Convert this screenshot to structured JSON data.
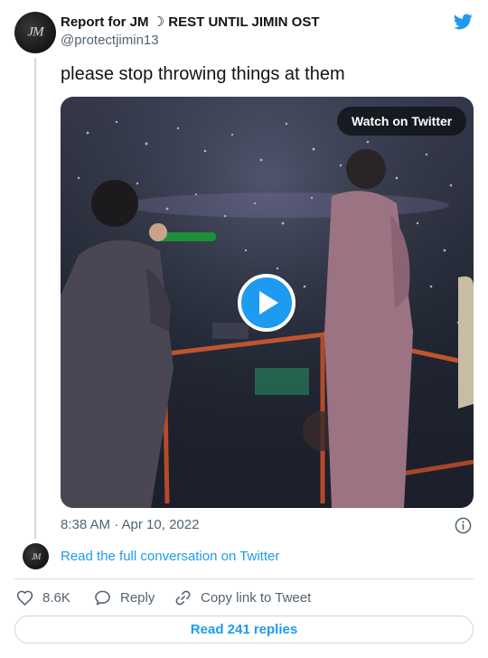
{
  "tweet": {
    "author": {
      "display_name": "Report for JM ☽ REST UNTIL JIMIN OST",
      "handle": "@protectjimin13",
      "avatar_monogram": "JM"
    },
    "text": "please stop throwing things at them",
    "timestamp": "8:38 AM · Apr 10, 2022",
    "media": {
      "type": "video",
      "watch_label": "Watch on Twitter"
    }
  },
  "conversation": {
    "read_full_label": "Read the full conversation on Twitter"
  },
  "actions": {
    "like_count": "8.6K",
    "reply_label": "Reply",
    "copy_link_label": "Copy link to Tweet"
  },
  "footer": {
    "read_replies_label": "Read 241 replies"
  },
  "icons": {
    "logo": "twitter-bird-icon",
    "info": "info-icon",
    "like": "heart-icon",
    "reply": "speech-bubble-icon",
    "copy": "link-icon",
    "play": "play-icon"
  },
  "colors": {
    "accent": "#1d9bf0",
    "text": "#0f1419",
    "muted": "#536471",
    "border": "#cfd9de"
  }
}
